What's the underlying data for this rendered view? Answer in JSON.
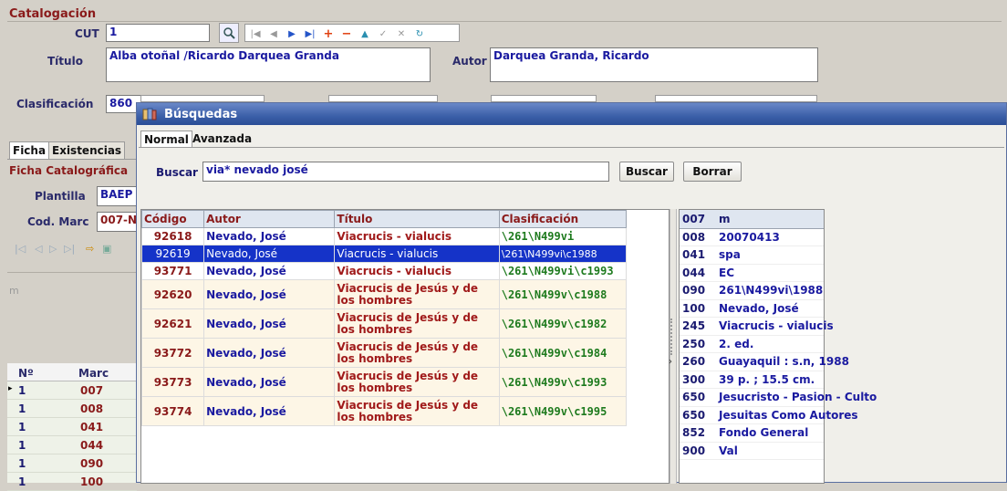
{
  "form": {
    "section_title": "Catalogación",
    "cut_label": "CUT",
    "cut_value": "1",
    "titulo_label": "Título",
    "titulo_value": "Alba otoñal /Ricardo Darquea Granda",
    "autor_label": "Autor",
    "autor_value": "Darquea Granda, Ricardo",
    "clasificacion_label": "Clasificación",
    "clasificacion_value": "860"
  },
  "left_panel": {
    "tab_ficha": "Ficha",
    "tab_existencias": "Existencias",
    "ficha_catalografica": "Ficha Catalográfica",
    "plantilla_label": "Plantilla",
    "plantilla_value": "BAEP",
    "codmarc_label": "Cod. Marc",
    "codmarc_value": "007-N",
    "m_label": "m",
    "grid_headers": [
      "Nº",
      "Marc"
    ],
    "grid_rows": [
      {
        "n": "1",
        "marc": "007"
      },
      {
        "n": "1",
        "marc": "008"
      },
      {
        "n": "1",
        "marc": "041"
      },
      {
        "n": "1",
        "marc": "044"
      },
      {
        "n": "1",
        "marc": "090"
      },
      {
        "n": "1",
        "marc": "100"
      }
    ]
  },
  "dialog": {
    "title": "Búsquedas",
    "tab_normal": "Normal",
    "tab_avanzada": "Avanzada",
    "buscar_label": "Buscar",
    "buscar_value": "via* nevado josé",
    "buscar_button": "Buscar",
    "borrar_button": "Borrar",
    "results_headers": [
      "Código",
      "Autor",
      "Título",
      "Clasificación"
    ],
    "results": [
      {
        "codigo": "92618",
        "autor": "Nevado, José",
        "titulo": "Viacrucis - vialucis",
        "clas": "\\261\\N499vi"
      },
      {
        "codigo": "92619",
        "autor": "Nevado, José",
        "titulo": "Viacrucis - vialucis",
        "clas": "\\261\\N499vi\\c1988"
      },
      {
        "codigo": "93771",
        "autor": "Nevado, José",
        "titulo": "Viacrucis - vialucis",
        "clas": "\\261\\N499vi\\c1993"
      },
      {
        "codigo": "92620",
        "autor": "Nevado, José",
        "titulo": "Viacrucis de Jesús y de los hombres",
        "clas": "\\261\\N499v\\c1988"
      },
      {
        "codigo": "92621",
        "autor": "Nevado, José",
        "titulo": "Viacrucis de Jesús y de los hombres",
        "clas": "\\261\\N499v\\c1982"
      },
      {
        "codigo": "93772",
        "autor": "Nevado, José",
        "titulo": "Viacrucis de Jesús y de los hombres",
        "clas": "\\261\\N499v\\c1984"
      },
      {
        "codigo": "93773",
        "autor": "Nevado, José",
        "titulo": "Viacrucis de Jesús y de los hombres",
        "clas": "\\261\\N499v\\c1993"
      },
      {
        "codigo": "93774",
        "autor": "Nevado, José",
        "titulo": "Viacrucis de Jesús y de los hombres",
        "clas": "\\261\\N499v\\c1995"
      }
    ],
    "marc_header_value": "m",
    "marc_rows": [
      {
        "tag": "007",
        "value": "m"
      },
      {
        "tag": "008",
        "value": "20070413"
      },
      {
        "tag": "041",
        "value": "spa"
      },
      {
        "tag": "044",
        "value": "EC"
      },
      {
        "tag": "090",
        "value": "261\\N499vi\\1988"
      },
      {
        "tag": "100",
        "value": "Nevado, José"
      },
      {
        "tag": "245",
        "value": "Viacrucis - vialucis"
      },
      {
        "tag": "250",
        "value": "2. ed."
      },
      {
        "tag": "260",
        "value": "Guayaquil : s.n, 1988"
      },
      {
        "tag": "300",
        "value": "39 p. ; 15.5 cm."
      },
      {
        "tag": "650",
        "value": "Jesucristo - Pasion - Culto"
      },
      {
        "tag": "650",
        "value": "Jesuitas Como Autores"
      },
      {
        "tag": "852",
        "value": "Fondo General"
      },
      {
        "tag": "900",
        "value": "Val"
      }
    ]
  },
  "colors": {
    "selection": "#1533c8",
    "code": "#8a1a1a",
    "author": "#1a1aa0",
    "classification": "#1d7a1d"
  }
}
